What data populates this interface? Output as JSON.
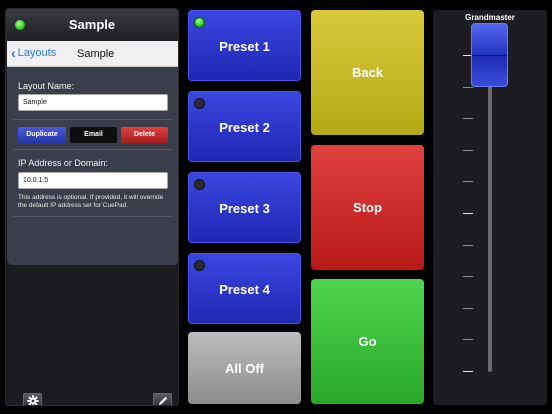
{
  "window": {
    "title": "Sample"
  },
  "layout_popover": {
    "back_label": "Layouts",
    "title": "Sample",
    "layout_name_label": "Layout Name:",
    "layout_name_value": "Sample",
    "buttons": {
      "duplicate": "Duplicate",
      "email": "Email",
      "delete": "Delete"
    },
    "ip_label": "IP Address or Domain:",
    "ip_value": "10.0.1.5",
    "ip_note": "This address is optional.  If provided, it will override the default IP address set for CuePad."
  },
  "toolbar": {
    "settings_icon": "gear-icon",
    "edit_icon": "pencil-icon"
  },
  "presets": [
    {
      "label": "Preset 1",
      "active": true
    },
    {
      "label": "Preset 2",
      "active": false
    },
    {
      "label": "Preset 3",
      "active": false
    },
    {
      "label": "Preset 4",
      "active": false
    }
  ],
  "all_off_label": "All Off",
  "actions": {
    "back": "Back",
    "stop": "Stop",
    "go": "Go"
  },
  "grandmaster": {
    "label": "Grandmaster",
    "level_percent": 100
  },
  "colors": {
    "preset_blue": "#2b36cf",
    "back_yellow": "#c8bc24",
    "stop_red": "#cc2a2a",
    "go_green": "#3cc23c",
    "indicator_on": "#2fd12a",
    "link_blue": "#2f7ad8"
  }
}
